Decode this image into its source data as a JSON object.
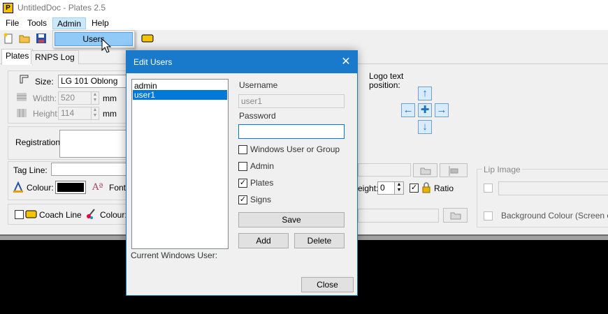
{
  "window": {
    "title": "UntitledDoc - Plates 2.5",
    "app_icon_letter": "P"
  },
  "menu": {
    "file": "File",
    "tools": "Tools",
    "admin": "Admin",
    "help": "Help"
  },
  "admin_menu": {
    "users": "Users"
  },
  "tabs": {
    "plates": "Plates",
    "rnps_log": "RNPS Log"
  },
  "size_panel": {
    "size_label": "Size:",
    "size_value": "LG 101 Oblong",
    "width_label": "Width:",
    "width_value": "520",
    "width_unit": "mm",
    "height_label": "Height:",
    "height_value": "114",
    "height_unit": "mm"
  },
  "registration": {
    "label": "Registration:"
  },
  "tagline": {
    "label": "Tag Line:",
    "colour_label": "Colour:",
    "colour_value": "#000000",
    "font_label": "Font:"
  },
  "coach_line": {
    "label": "Coach Line",
    "colour_label": "Colour:"
  },
  "logo": {
    "position_label": "Logo text\nposition:",
    "height_label": "eight:",
    "height_value": "0",
    "ratio_label": "Ratio"
  },
  "lip_image": {
    "title": "Lip Image",
    "background_label": "Background Colour (Screen onl"
  },
  "dialog": {
    "title": "Edit Users",
    "close_glyph": "✕",
    "users": [
      "admin",
      "user1"
    ],
    "selected_user_index": 1,
    "username_label": "Username",
    "username_value": "user1",
    "password_label": "Password",
    "password_value": "",
    "windows_user_label": "Windows User or Group",
    "admin_label": "Admin",
    "plates_label": "Plates",
    "signs_label": "Signs",
    "windows_user_checked": false,
    "admin_checked": false,
    "plates_checked": true,
    "signs_checked": true,
    "save_button": "Save",
    "add_button": "Add",
    "delete_button": "Delete",
    "close_button": "Close",
    "current_windows_user_label": "Current Windows User:"
  },
  "colors": {
    "dialog_titlebar": "#1979ca",
    "selection": "#0078d7",
    "menu_highlight": "#91c9f7"
  }
}
